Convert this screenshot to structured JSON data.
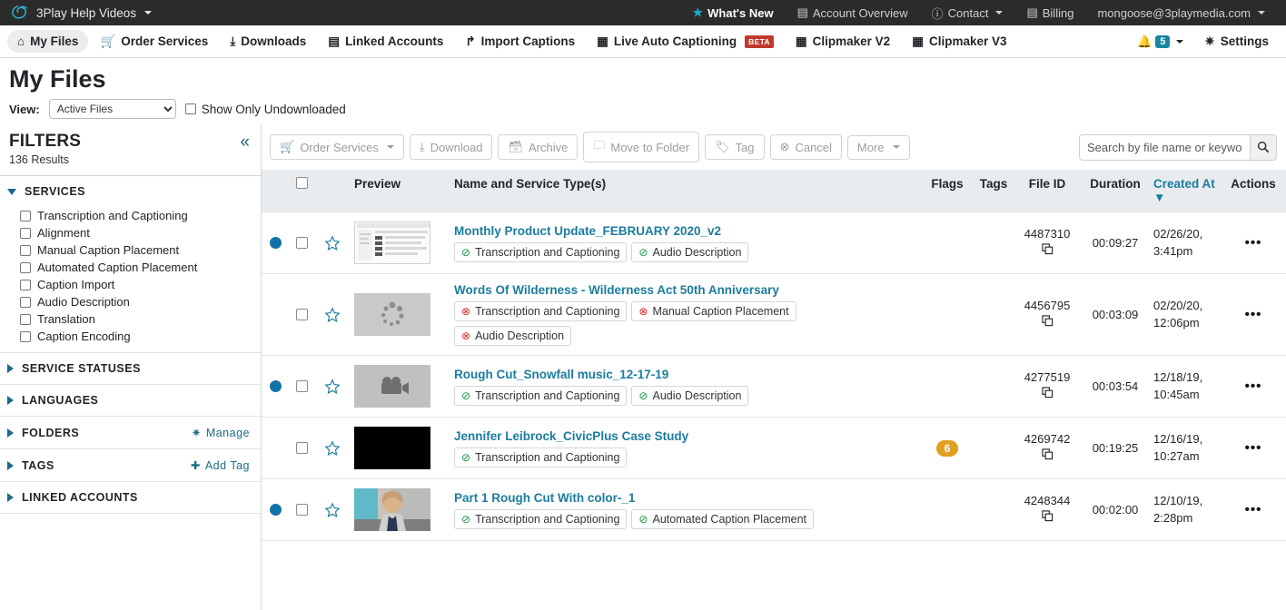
{
  "topbar": {
    "logo_icon": "3play-logo-icon",
    "account_name": "3Play Help Videos",
    "whats_new": "What's New",
    "account_overview": "Account Overview",
    "contact": "Contact",
    "billing": "Billing",
    "user_email": "mongoose@3playmedia.com"
  },
  "nav": {
    "items": [
      {
        "label": "My Files",
        "icon": "home-icon",
        "active": true
      },
      {
        "label": "Order Services",
        "icon": "cart-icon",
        "active": false
      },
      {
        "label": "Downloads",
        "icon": "download-icon",
        "active": false
      },
      {
        "label": "Linked Accounts",
        "icon": "id-card-icon",
        "active": false
      },
      {
        "label": "Import Captions",
        "icon": "share-icon",
        "active": false
      },
      {
        "label": "Live Auto Captioning",
        "icon": "calendar-icon",
        "active": false,
        "badge": "BETA"
      },
      {
        "label": "Clipmaker V2",
        "icon": "film-icon",
        "active": false
      },
      {
        "label": "Clipmaker V3",
        "icon": "film-icon",
        "active": false
      }
    ],
    "notification_count": "5",
    "settings": "Settings"
  },
  "page": {
    "title": "My Files",
    "view_label": "View:",
    "view_value": "Active Files",
    "view_options": [
      "Active Files"
    ],
    "undownloaded_label": "Show Only Undownloaded"
  },
  "filters": {
    "title": "FILTERS",
    "results": "136 Results",
    "collapse_icon": "chevron-double-left-icon",
    "sections": [
      {
        "title": "SERVICES",
        "expanded": true,
        "options": [
          "Transcription and Captioning",
          "Alignment",
          "Manual Caption Placement",
          "Automated Caption Placement",
          "Caption Import",
          "Audio Description",
          "Translation",
          "Caption Encoding"
        ]
      },
      {
        "title": "SERVICE STATUSES",
        "expanded": false,
        "options": []
      },
      {
        "title": "LANGUAGES",
        "expanded": false,
        "options": []
      },
      {
        "title": "FOLDERS",
        "expanded": false,
        "options": [],
        "action": "Manage",
        "action_icon": "gear-icon"
      },
      {
        "title": "TAGS",
        "expanded": false,
        "options": [],
        "action": "Add Tag",
        "action_icon": "plus-icon"
      },
      {
        "title": "LINKED ACCOUNTS",
        "expanded": false,
        "options": []
      }
    ]
  },
  "toolbar": {
    "buttons": [
      {
        "label": "Order Services",
        "icon": "cart-icon",
        "caret": true
      },
      {
        "label": "Download",
        "icon": "download-icon",
        "caret": false
      },
      {
        "label": "Archive",
        "icon": "archive-icon",
        "caret": false
      },
      {
        "label": "Move to Folder",
        "icon": "folder-icon",
        "caret": false
      },
      {
        "label": "Tag",
        "icon": "tag-icon",
        "caret": false
      },
      {
        "label": "Cancel",
        "icon": "cancel-icon",
        "caret": false
      },
      {
        "label": "More",
        "icon": "",
        "caret": true
      }
    ],
    "search_placeholder": "Search by file name or keyword",
    "search_value": "",
    "search_icon": "search-icon"
  },
  "table": {
    "columns": [
      {
        "label": "",
        "key": "dot",
        "link": false
      },
      {
        "label": "",
        "key": "check",
        "link": false
      },
      {
        "label": "",
        "key": "star",
        "link": false
      },
      {
        "label": "Preview",
        "key": "preview",
        "link": false
      },
      {
        "label": "Name and Service Type(s)",
        "key": "name",
        "link": true
      },
      {
        "label": "Flags",
        "key": "flags",
        "link": true
      },
      {
        "label": "Tags",
        "key": "tags",
        "link": false
      },
      {
        "label": "File ID",
        "key": "file_id",
        "link": true
      },
      {
        "label": "Duration",
        "key": "duration",
        "link": true
      },
      {
        "label": "Created At",
        "key": "created_at",
        "link": true,
        "sort": "▼"
      },
      {
        "label": "Actions",
        "key": "actions",
        "link": false
      }
    ],
    "rows": [
      {
        "unviewed": true,
        "thumb": "screenshot-thumbnail",
        "name": "Monthly Product Update_FEBRUARY 2020_v2",
        "services": [
          {
            "label": "Transcription and Captioning",
            "status": "complete"
          },
          {
            "label": "Audio Description",
            "status": "complete"
          }
        ],
        "flags": "",
        "tags": "",
        "file_id": "4487310",
        "duration": "00:09:27",
        "created_at": "02/26/20, 3:41pm"
      },
      {
        "unviewed": false,
        "thumb": "loading-spinner-thumbnail",
        "name": "Words Of Wilderness - Wilderness Act 50th Anniversary",
        "services": [
          {
            "label": "Transcription and Captioning",
            "status": "error"
          },
          {
            "label": "Manual Caption Placement",
            "status": "error"
          },
          {
            "label": "Audio Description",
            "status": "error"
          }
        ],
        "flags": "",
        "tags": "",
        "file_id": "4456795",
        "duration": "00:03:09",
        "created_at": "02/20/20, 12:06pm"
      },
      {
        "unviewed": true,
        "thumb": "video-camera-thumbnail",
        "name": "Rough Cut_Snowfall music_12-17-19",
        "services": [
          {
            "label": "Transcription and Captioning",
            "status": "complete"
          },
          {
            "label": "Audio Description",
            "status": "complete"
          }
        ],
        "flags": "",
        "tags": "",
        "file_id": "4277519",
        "duration": "00:03:54",
        "created_at": "12/18/19, 10:45am"
      },
      {
        "unviewed": false,
        "thumb": "black-thumbnail",
        "name": "Jennifer Leibrock_CivicPlus Case Study",
        "services": [
          {
            "label": "Transcription and Captioning",
            "status": "complete"
          }
        ],
        "flags": "6",
        "tags": "",
        "file_id": "4269742",
        "duration": "00:19:25",
        "created_at": "12/16/19, 10:27am"
      },
      {
        "unviewed": true,
        "thumb": "person-photo-thumbnail",
        "name": "Part 1 Rough Cut With color-_1",
        "services": [
          {
            "label": "Transcription and Captioning",
            "status": "complete"
          },
          {
            "label": "Automated Caption Placement",
            "status": "complete"
          }
        ],
        "flags": "",
        "tags": "",
        "file_id": "4248344",
        "duration": "00:02:00",
        "created_at": "12/10/19, 2:28pm"
      }
    ],
    "row_action_icon": "ellipsis-icon",
    "copy_icon": "copy-icon",
    "star_icon": "star-outline-icon"
  },
  "colors": {
    "topbar_bg": "#2b2b2b",
    "link": "#1b7c9e",
    "accent_teal": "#17859e",
    "flag_orange": "#e0a021",
    "success_green": "#1a9440",
    "error_red": "#d9252a",
    "beta_red": "#c0392b",
    "unviewed_dot": "#1272a8"
  }
}
